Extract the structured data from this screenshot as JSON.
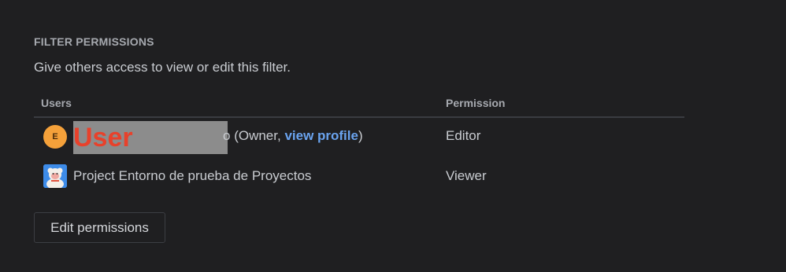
{
  "section": {
    "title": "FILTER PERMISSIONS",
    "description": "Give others access to view or edit this filter."
  },
  "table": {
    "headers": {
      "users": "Users",
      "permission": "Permission"
    },
    "rows": [
      {
        "avatar_initial": "E",
        "redaction_label": "User",
        "name_tail": "o",
        "owner_prefix": " (Owner, ",
        "owner_link": "view profile",
        "owner_suffix": ")",
        "permission": "Editor"
      },
      {
        "name": "Project Entorno de prueba de Proyectos",
        "permission": "Viewer"
      }
    ]
  },
  "actions": {
    "edit_label": "Edit permissions"
  },
  "colors": {
    "background": "#1f1f21",
    "link": "#6aa3ee",
    "avatar_user": "#f5a13a",
    "avatar_project": "#3d8be8",
    "redaction": "#8c8c8c",
    "redaction_text": "#e8412b"
  }
}
